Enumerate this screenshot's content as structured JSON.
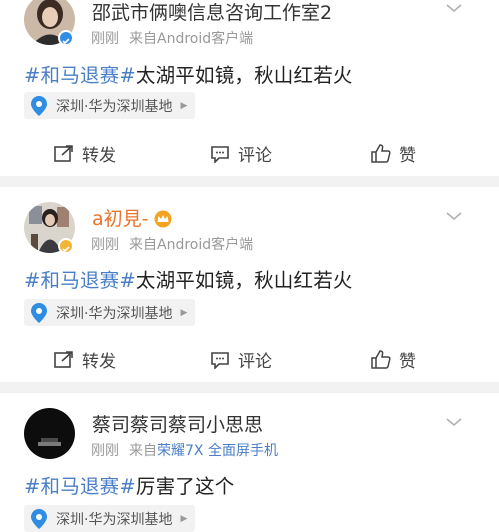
{
  "posts": [
    {
      "username": "邵武市俩噢信息咨询工作室2",
      "time": "刚刚",
      "source_prefix": "来自",
      "source": "Android客户端",
      "hashtag": "#和马退赛#",
      "text": "太湖平如镜，秋山红若火",
      "location": "深圳·华为深圳基地",
      "actions": {
        "repost": "转发",
        "comment": "评论",
        "like": "赞"
      }
    },
    {
      "username": "a初見-",
      "time": "刚刚",
      "source_prefix": "来自",
      "source": "Android客户端",
      "hashtag": "#和马退赛#",
      "text": "太湖平如镜，秋山红若火",
      "location": "深圳·华为深圳基地",
      "actions": {
        "repost": "转发",
        "comment": "评论",
        "like": "赞"
      }
    },
    {
      "username": "蔡司蔡司蔡司小思思",
      "time": "刚刚",
      "source_prefix": "来自",
      "source": "荣耀7X 全面屏手机",
      "hashtag": "#和马退赛#",
      "text": "厉害了这个",
      "location": "深圳·华为深圳基地"
    }
  ],
  "colors": {
    "link": "#4a7fc7",
    "meta": "#999999",
    "separator": "#f2f2f2",
    "vip_badge": "#f2b535",
    "verified_badge": "#2f8de4",
    "location_pin": "#2f8de4"
  },
  "icons": {
    "repost": "repost-icon",
    "comment": "comment-icon",
    "like": "thumbs-up-icon",
    "location": "location-pin-icon",
    "menu": "chevron-down-icon",
    "verified": "verified-badge-icon",
    "vip": "crown-icon"
  }
}
